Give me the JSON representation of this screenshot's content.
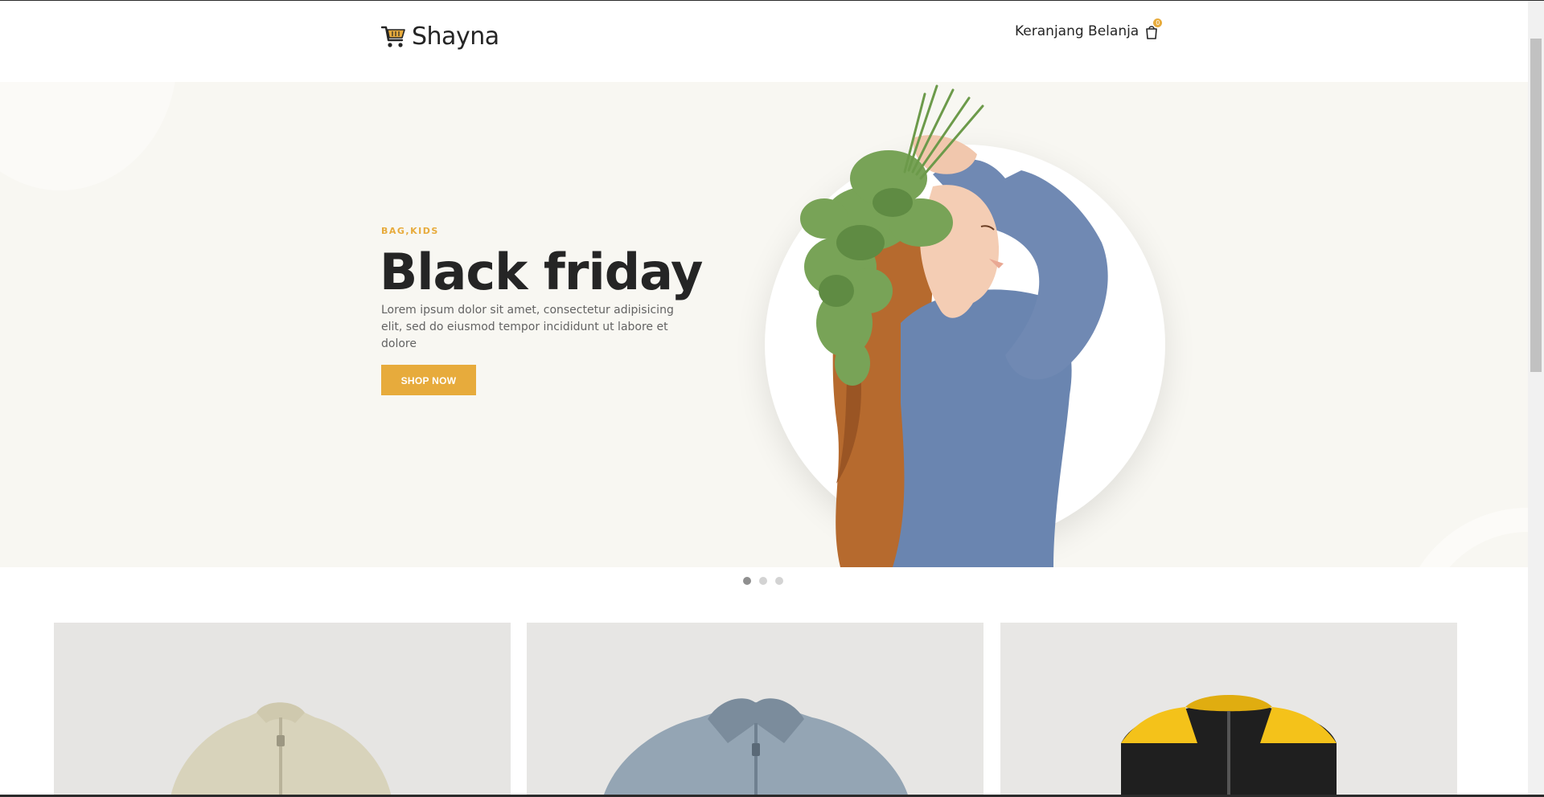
{
  "header": {
    "brand": "Shayna",
    "cart_label": "Keranjang Belanja",
    "cart_count": "0"
  },
  "hero": {
    "category": "BAG,KIDS",
    "title": "Black friday",
    "description": "Lorem ipsum dolor sit amet, consectetur adipisicing elit, sed do eiusmod tempor incididunt ut labore et dolore",
    "button_label": "SHOP NOW"
  },
  "slider": {
    "slides": 3,
    "active_slide": 1
  },
  "products": [
    {
      "name": "beige-fleece-jacket"
    },
    {
      "name": "blue-shearling-jacket"
    },
    {
      "name": "yellow-black-puffer-vest"
    }
  ],
  "colors": {
    "accent": "#e7ab3c",
    "hero_bg": "#f8f7f2",
    "text": "#252525"
  }
}
